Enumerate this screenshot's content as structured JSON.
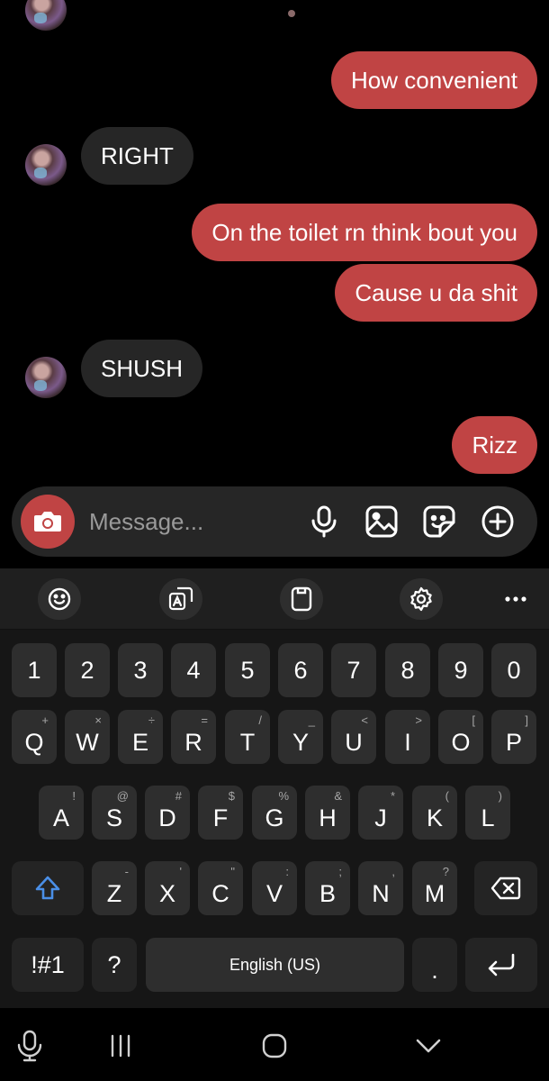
{
  "messages": [
    {
      "text": "How convenient"
    },
    {
      "text": "RIGHT"
    },
    {
      "text": "On the toilet rn think bout you"
    },
    {
      "text": "Cause u da shit"
    },
    {
      "text": "SHUSH"
    },
    {
      "text": "Rizz"
    }
  ],
  "composer": {
    "placeholder": "Message...",
    "icons": [
      "camera-icon",
      "microphone-icon",
      "gallery-icon",
      "sticker-icon",
      "add-icon"
    ]
  },
  "keyboard": {
    "toolbar_icons": [
      "emoji-icon",
      "translate-icon",
      "clipboard-icon",
      "settings-icon",
      "more-icon"
    ],
    "number_row": [
      "1",
      "2",
      "3",
      "4",
      "5",
      "6",
      "7",
      "8",
      "9",
      "0"
    ],
    "row1": {
      "keys": [
        "Q",
        "W",
        "E",
        "R",
        "T",
        "Y",
        "U",
        "I",
        "O",
        "P"
      ],
      "hints": [
        "+",
        "×",
        "÷",
        "=",
        "/",
        "_",
        "<",
        ">",
        "[",
        "]"
      ]
    },
    "row2": {
      "keys": [
        "A",
        "S",
        "D",
        "F",
        "G",
        "H",
        "J",
        "K",
        "L"
      ],
      "hints": [
        "!",
        "@",
        "#",
        "$",
        "%",
        "&",
        "*",
        "(",
        ")"
      ]
    },
    "row3": {
      "keys": [
        "Z",
        "X",
        "C",
        "V",
        "B",
        "N",
        "M"
      ],
      "hints": [
        "-",
        "'",
        "\"",
        ":",
        ";",
        ",",
        "?"
      ]
    },
    "symbols_label": "!#1",
    "question_label": "?",
    "space_label": "English (US)",
    "period_label": ".",
    "colors": {
      "key": "#2e2e2e",
      "shift_accent": "#4a8fe7"
    }
  },
  "colors": {
    "outgoing_bubble": "#c04444",
    "incoming_bubble": "#262626",
    "background": "#000000"
  },
  "nav_icons": [
    "voice-input-icon",
    "recent-apps-icon",
    "home-icon",
    "back-icon"
  ]
}
